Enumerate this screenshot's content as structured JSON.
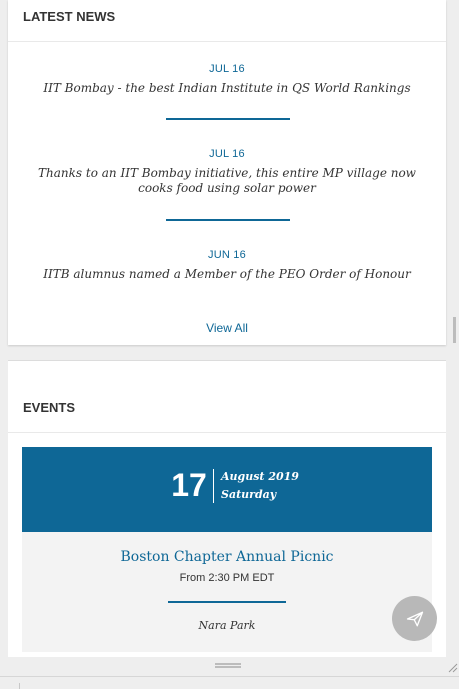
{
  "news": {
    "title": "LATEST NEWS",
    "items": [
      {
        "date": "JUL 16",
        "headline": "IIT Bombay - the best Indian Institute in QS World Rankings"
      },
      {
        "date": "JUL 16",
        "headline": "Thanks to an IIT Bombay initiative, this entire MP village now cooks food using solar power"
      },
      {
        "date": "JUN 16",
        "headline": "IITB alumnus named a Member of the PEO Order of Honour"
      }
    ],
    "view_all_label": "View All"
  },
  "events": {
    "title": "EVENTS",
    "items": [
      {
        "day": "17",
        "month_year": "August 2019",
        "weekday": "Saturday",
        "title": "Boston Chapter Annual Picnic",
        "time": "From 2:30 PM EDT",
        "location": "Nara Park"
      }
    ]
  },
  "send_button": {
    "icon": "paper-plane-icon"
  },
  "colors": {
    "accent": "#0e6796",
    "background": "#eeeeee",
    "panel": "#ffffff",
    "event_body": "#f3f3f3",
    "fab": "#b8b8b8"
  }
}
